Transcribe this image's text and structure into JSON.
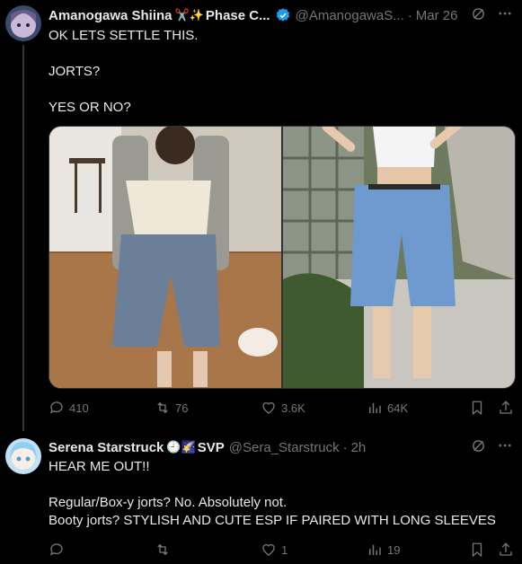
{
  "tweet1": {
    "name": "Amanogawa Shiina",
    "name_emoji": "✂️✨",
    "name_tail": "Phase C...",
    "handle": "@AmanogawaS...",
    "date": "Mar 26",
    "text": "OK LETS SETTLE THIS.\n\nJORTS?\n\nYES OR NO?",
    "stats": {
      "replies": "410",
      "reposts": "76",
      "likes": "3.6K",
      "views": "64K"
    }
  },
  "tweet2": {
    "name": "Serena Starstruck",
    "name_emoji": "🕘🌠",
    "name_tail": "SVP",
    "handle": "@Sera_Starstruck",
    "date": "2h",
    "text": "HEAR ME OUT!!\n\nRegular/Box-y jorts? No. Absolutely not.\nBooty jorts? STYLISH AND CUTE ESP IF PAIRED WITH LONG SLEEVES",
    "stats": {
      "replies": "",
      "reposts": "",
      "likes": "1",
      "views": "19"
    }
  },
  "icons": {
    "reply": "reply-icon",
    "repost": "repost-icon",
    "like": "heart-icon",
    "views": "views-icon",
    "bookmark": "bookmark-icon",
    "share": "share-icon",
    "grok": "grok-icon",
    "more": "more-icon",
    "verified": "verified-badge-icon"
  },
  "colors": {
    "background": "#000000",
    "text": "#e7e9ea",
    "muted": "#71767b",
    "verified": "#1d9bf0"
  }
}
